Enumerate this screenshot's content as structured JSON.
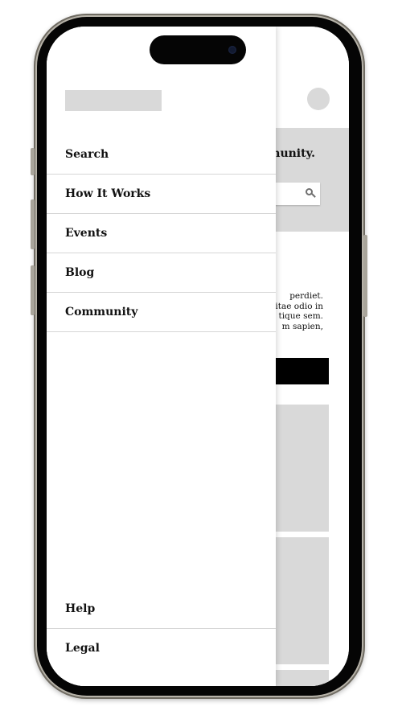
{
  "drawer": {
    "menu_items": [
      {
        "label": "Search"
      },
      {
        "label": "How It Works"
      },
      {
        "label": "Events"
      },
      {
        "label": "Blog"
      },
      {
        "label": "Community"
      }
    ],
    "bottom_items": [
      {
        "label": "Help"
      },
      {
        "label": "Legal"
      }
    ]
  },
  "page": {
    "hero_title_partial": "munity.",
    "paragraph_lines": [
      "perdiet.",
      "vitae odio in",
      "tique sem.",
      "m sapien,"
    ]
  },
  "icons": {
    "search": "search-icon"
  },
  "colors": {
    "placeholder": "#d9d9d9",
    "button_dark": "#000000",
    "text": "#111111"
  }
}
